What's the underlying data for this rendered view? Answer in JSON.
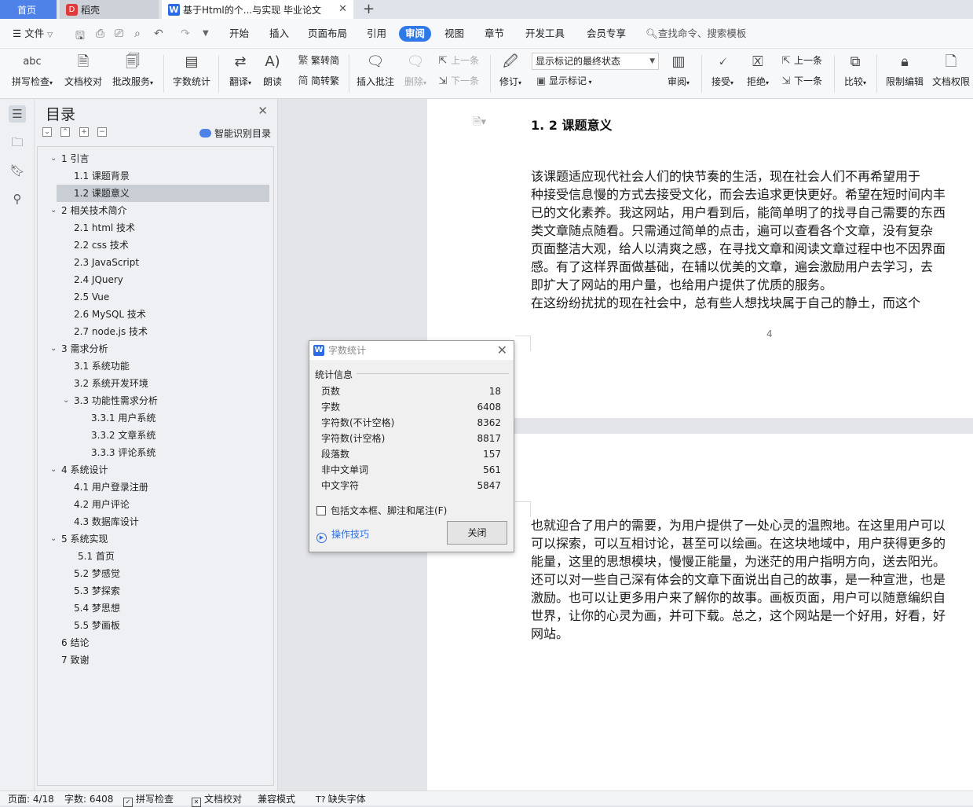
{
  "tabs": {
    "home": "首页",
    "shell": "稻壳",
    "doc": "基于Html的个...与实现 毕业论文",
    "new_tab": "+"
  },
  "menu": {
    "file": "文件",
    "items": [
      "开始",
      "插入",
      "页面布局",
      "引用",
      "审阅",
      "视图",
      "章节",
      "开发工具",
      "会员专享"
    ],
    "active": "审阅",
    "search_placeholder": "查找命令、搜索模板"
  },
  "ribbon": {
    "spell_check": "拼写检查",
    "doc_proof": "文档校对",
    "review_service": "批改服务",
    "word_count": "字数统计",
    "translate": "翻译",
    "read_aloud": "朗读",
    "to_traditional": "繁转简",
    "to_simplified": "简转繁",
    "insert_comment": "插入批注",
    "delete": "删除",
    "prev": "上一条",
    "next": "下一条",
    "track_changes": "修订",
    "markup_state": "显示标记的最终状态",
    "show_markup": "显示标记",
    "review": "审阅",
    "accept": "接受",
    "reject": "拒绝",
    "prev_change": "上一条",
    "next_change": "下一条",
    "compare": "比较",
    "restrict_edit": "限制编辑",
    "doc_permission": "文档权限"
  },
  "toc": {
    "title": "目录",
    "smart": "智能识别目录",
    "items": [
      {
        "label": "1  引言",
        "level": 1,
        "expanded": true
      },
      {
        "label": "1.1  课题背景",
        "level": 2
      },
      {
        "label": "1.2 课题意义",
        "level": 2,
        "selected": true
      },
      {
        "label": "2 相关技术简介",
        "level": 1,
        "expanded": true
      },
      {
        "label": "2.1 html 技术",
        "level": 2
      },
      {
        "label": "2.2 css 技术",
        "level": 2
      },
      {
        "label": "2.3 JavaScript",
        "level": 2
      },
      {
        "label": "2.4 JQuery",
        "level": 2
      },
      {
        "label": "2.5 Vue",
        "level": 2
      },
      {
        "label": "2.6 MySQL 技术",
        "level": 2
      },
      {
        "label": "2.7 node.js 技术",
        "level": 2
      },
      {
        "label": "3 需求分析",
        "level": 1,
        "expanded": true
      },
      {
        "label": "3.1  系统功能",
        "level": 2
      },
      {
        "label": "3.2  系统开发环境",
        "level": 2
      },
      {
        "label": "3.3 功能性需求分析",
        "level": 2,
        "expanded": true
      },
      {
        "label": "3.3.1 用户系统",
        "level": 3
      },
      {
        "label": "3.3.2  文章系统",
        "level": 3
      },
      {
        "label": "3.3.3    评论系统",
        "level": 3
      },
      {
        "label": "4  系统设计",
        "level": 1,
        "expanded": true
      },
      {
        "label": "4.1  用户登录注册",
        "level": 2
      },
      {
        "label": "4.2  用户评论",
        "level": 2
      },
      {
        "label": "4.3  数据库设计",
        "level": 2
      },
      {
        "label": "5  系统实现",
        "level": 1,
        "expanded": true
      },
      {
        "label": "5.1  首页",
        "level": 2,
        "extra_indent": true
      },
      {
        "label": "5.2  梦感觉",
        "level": 2
      },
      {
        "label": "5.3  梦探索",
        "level": 2
      },
      {
        "label": "5.4 梦思想",
        "level": 2
      },
      {
        "label": "5.5 梦画板",
        "level": 2
      },
      {
        "label": "6  结论",
        "level": 1
      },
      {
        "label": "7  致谢",
        "level": 1
      }
    ]
  },
  "document": {
    "heading": "1. 2 课题意义",
    "page1_lines": [
      "        该课题适应现代社会人们的快节奏的生活，现在社会人们不再希望用于",
      "种接受信息慢的方式去接受文化，而会去追求更快更好。希望在短时间内丰",
      "已的文化素养。我这网站，用户看到后，能简单明了的找寻自己需要的东西",
      "类文章随点随看。只需通过简单的点击，遍可以查看各个文章，没有复杂",
      "页面整洁大观，给人以清爽之感，在寻找文章和阅读文章过程中也不因界面",
      "感。有了这样界面做基础，在辅以优美的文章，遍会激励用户去学习，去",
      "即扩大了网站的用户量，也给用户提供了优质的服务。",
      "        在这纷纷扰扰的现在社会中，总有些人想找块属于自己的静土，而这个"
    ],
    "page_number": "4",
    "page2_lines": [
      "也就迎合了用户的需要，为用户提供了一处心灵的温煦地。在这里用户可以",
      "可以探索，可以互相讨论，甚至可以绘画。在这块地域中，用户获得更多的",
      "能量，这里的思想模块，慢慢正能量，为迷茫的用户指明方向，送去阳光。",
      "还可以对一些自己深有体会的文章下面说出自己的故事，是一种宣泄，也是",
      "激励。也可以让更多用户来了解你的故事。画板页面，用户可以随意编织自",
      "世界，让你的心灵为画，并可下载。总之，这个网站是一个好用，好看，好",
      "网站。"
    ]
  },
  "dialog": {
    "title": "字数统计",
    "group": "统计信息",
    "stats": [
      {
        "label": "页数",
        "value": "18"
      },
      {
        "label": "字数",
        "value": "6408"
      },
      {
        "label": "字符数(不计空格)",
        "value": "8362"
      },
      {
        "label": "字符数(计空格)",
        "value": "8817"
      },
      {
        "label": "段落数",
        "value": "157"
      },
      {
        "label": "非中文单词",
        "value": "561"
      },
      {
        "label": "中文字符",
        "value": "5847"
      }
    ],
    "checkbox_label": "包括文本框、脚注和尾注(F)",
    "checkbox_checked": false,
    "tips": "操作技巧",
    "close_button": "关闭"
  },
  "status": {
    "page": "页面: 4/18",
    "words": "字数: 6408",
    "spell": "拼写检查",
    "proof": "文档校对",
    "compat": "兼容模式",
    "missing_font": "缺失字体"
  },
  "colors": {
    "accent": "#2f78e8",
    "home_tab": "#4f82e8",
    "selected_toc": "#c9cdd4"
  }
}
